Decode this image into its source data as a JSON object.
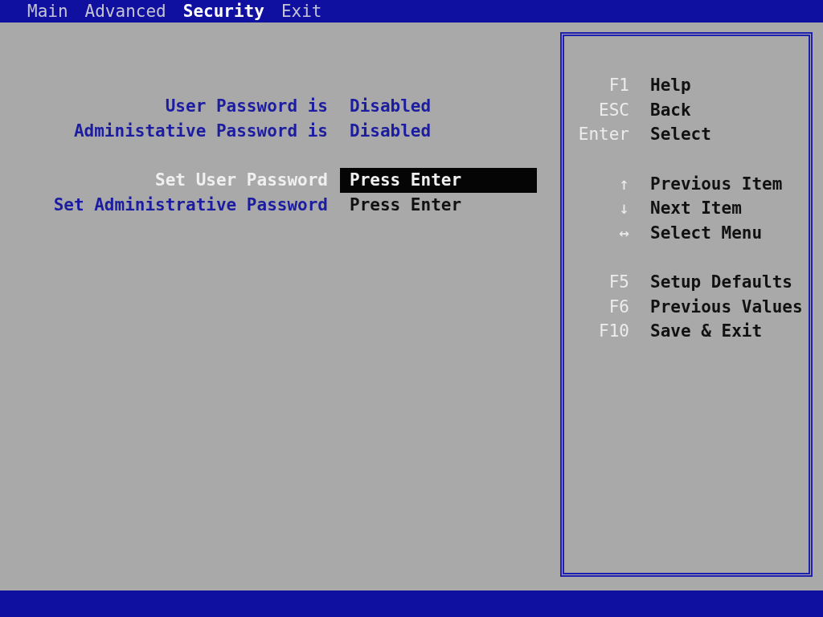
{
  "menu": [
    {
      "label": "Main",
      "selected": false
    },
    {
      "label": "Advanced",
      "selected": false
    },
    {
      "label": "Security",
      "selected": true
    },
    {
      "label": "Exit",
      "selected": false
    }
  ],
  "status": [
    {
      "label": "User Password is",
      "value": "Disabled"
    },
    {
      "label": "Administative Password is",
      "value": "Disabled"
    }
  ],
  "options": [
    {
      "label": "Set User Password",
      "value": "Press Enter",
      "selected": true
    },
    {
      "label": "Set Administrative Password",
      "value": "Press Enter",
      "selected": false
    }
  ],
  "help": [
    [
      {
        "key": "F1",
        "action": "Help"
      },
      {
        "key": "ESC",
        "action": "Back"
      },
      {
        "key": "Enter",
        "action": "Select"
      }
    ],
    [
      {
        "key": "↑",
        "action": "Previous Item"
      },
      {
        "key": "↓",
        "action": "Next Item"
      },
      {
        "key": "↔",
        "action": "Select Menu"
      }
    ],
    [
      {
        "key": "F5",
        "action": "Setup Defaults"
      },
      {
        "key": "F6",
        "action": "Previous Values"
      },
      {
        "key": "F10",
        "action": "Save & Exit"
      }
    ]
  ]
}
